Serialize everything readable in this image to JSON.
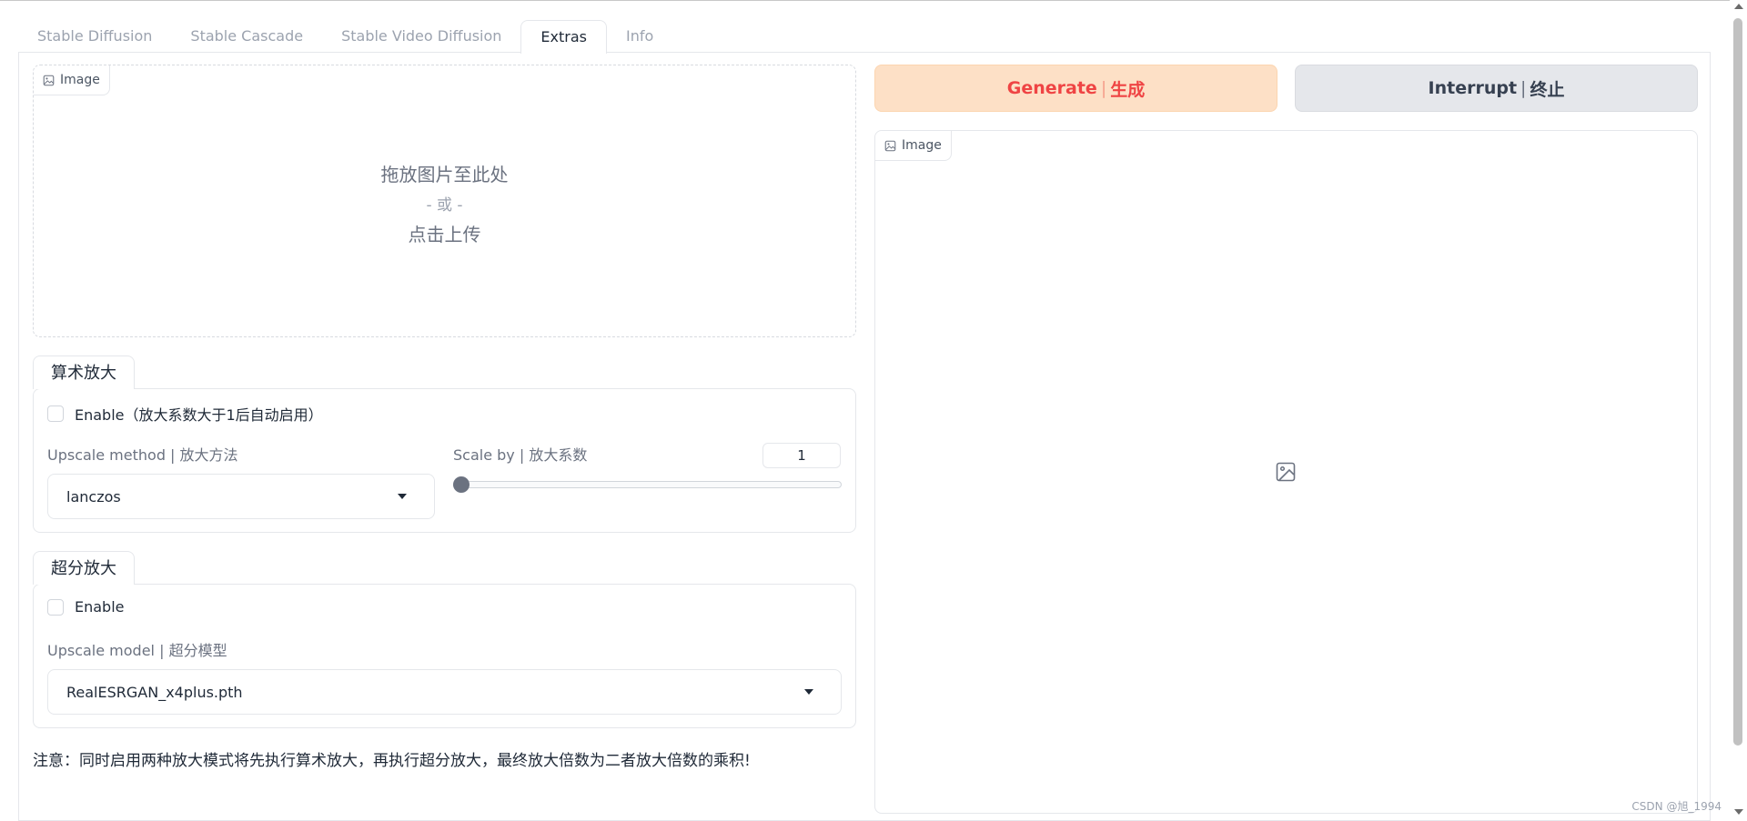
{
  "tabs": [
    "Stable Diffusion",
    "Stable Cascade",
    "Stable Video Diffusion",
    "Extras",
    "Info"
  ],
  "active_tab": "Extras",
  "upload": {
    "label": "Image",
    "drop_text": "拖放图片至此处",
    "or_text": "- 或 -",
    "click_text": "点击上传"
  },
  "arith": {
    "title": "算术放大",
    "enable_label": "Enable（放大系数大于1后自动启用）",
    "enabled": false,
    "method_label": "Upscale method | 放大方法",
    "method_value": "lanczos",
    "scale_label": "Scale by | 放大系数",
    "scale_value": "1"
  },
  "sr": {
    "title": "超分放大",
    "enable_label": "Enable",
    "enabled": false,
    "model_label": "Upscale model | 超分模型",
    "model_value": "RealESRGAN_x4plus.pth"
  },
  "note": "注意：同时启用两种放大模式将先执行算术放大，再执行超分放大，最终放大倍数为二者放大倍数的乘积!",
  "generate": {
    "en": "Generate",
    "sep": "|",
    "zh": "生成"
  },
  "interrupt": {
    "en": "Interrupt",
    "sep": "|",
    "zh": "终止"
  },
  "output": {
    "label": "Image"
  },
  "watermark": "CSDN @旭_1994",
  "colors": {
    "generate_bg": "#fde0c6",
    "generate_text": "#ef4444",
    "interrupt_bg": "#e5e7eb"
  }
}
